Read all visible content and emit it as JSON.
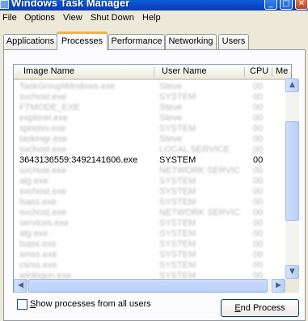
{
  "window": {
    "title": "Windows Task Manager",
    "min_icon": "_",
    "max_icon": "□",
    "close_icon": "✕"
  },
  "menu": {
    "items": [
      "File",
      "Options",
      "View",
      "Shut Down",
      "Help"
    ]
  },
  "tabs": [
    {
      "label": "Applications",
      "active": false
    },
    {
      "label": "Processes",
      "active": true
    },
    {
      "label": "Performance",
      "active": false
    },
    {
      "label": "Networking",
      "active": false
    },
    {
      "label": "Users",
      "active": false
    }
  ],
  "processes": {
    "columns": [
      "Image Name",
      "User Name",
      "CPU",
      "Me"
    ],
    "rows": [
      {
        "image": "TaskGroupWindows.exe",
        "user": "Steve",
        "cpu": "00",
        "blurred": true
      },
      {
        "image": "svchost.exe",
        "user": "SYSTEM",
        "cpu": "00",
        "blurred": true
      },
      {
        "image": "FTMODE_EXE",
        "user": "Steve",
        "cpu": "00",
        "blurred": true
      },
      {
        "image": "explorer.exe",
        "user": "Steve",
        "cpu": "00",
        "blurred": true
      },
      {
        "image": "spoolsv.exe",
        "user": "SYSTEM",
        "cpu": "00",
        "blurred": true
      },
      {
        "image": "taskmgr.exe",
        "user": "Steve",
        "cpu": "00",
        "blurred": true
      },
      {
        "image": "svchost.exe",
        "user": "LOCAL SERVICE",
        "cpu": "00",
        "blurred": true
      },
      {
        "image": "3643136559:3492141606.exe",
        "user": "SYSTEM",
        "cpu": "00",
        "blurred": false
      },
      {
        "image": "svchost.exe",
        "user": "NETWORK SERVICE",
        "cpu": "00",
        "blurred": true
      },
      {
        "image": "alg.exe",
        "user": "SYSTEM",
        "cpu": "00",
        "blurred": true
      },
      {
        "image": "svchost.exe",
        "user": "SYSTEM",
        "cpu": "00",
        "blurred": true
      },
      {
        "image": "lsass.exe",
        "user": "SYSTEM",
        "cpu": "00",
        "blurred": true
      },
      {
        "image": "svchost.exe",
        "user": "NETWORK SERVICE",
        "cpu": "00",
        "blurred": true
      },
      {
        "image": "services.exe",
        "user": "SYSTEM",
        "cpu": "00",
        "blurred": true
      },
      {
        "image": "alg.exe",
        "user": "SYSTEM",
        "cpu": "00",
        "blurred": true
      },
      {
        "image": "lsass.exe",
        "user": "SYSTEM",
        "cpu": "00",
        "blurred": true
      },
      {
        "image": "smss.exe",
        "user": "SYSTEM",
        "cpu": "00",
        "blurred": true
      },
      {
        "image": "csrss.exe",
        "user": "SYSTEM",
        "cpu": "00",
        "blurred": true
      },
      {
        "image": "winlogon.exe",
        "user": "SYSTEM",
        "cpu": "00",
        "blurred": true
      },
      {
        "image": "System",
        "user": "SYSTEM",
        "cpu": "00",
        "blurred": true
      }
    ]
  },
  "scrollbar": {
    "up_icon": "▲",
    "down_icon": "▼",
    "left_icon": "◀",
    "right_icon": "▶"
  },
  "footer": {
    "show_all_label_prefix": "S",
    "show_all_label_rest": "how processes from all users",
    "show_all_checked": false,
    "end_process_prefix": "E",
    "end_process_rest": "nd Process"
  }
}
